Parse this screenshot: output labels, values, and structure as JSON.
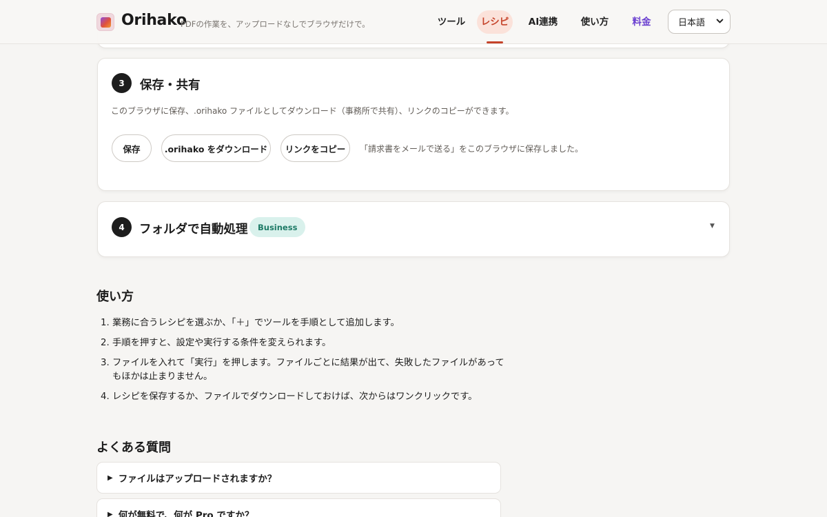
{
  "header": {
    "brand": "Orihako",
    "tagline": "PDFの作業を、アップロードなしでブラウザだけで。",
    "nav": [
      {
        "label": "ツール",
        "active": false
      },
      {
        "label": "レシピ",
        "active": true
      },
      {
        "label": "AI連携",
        "active": false
      },
      {
        "label": "使い方",
        "active": false
      },
      {
        "label": "料金",
        "active": false
      }
    ],
    "language": "日本語"
  },
  "step3": {
    "number": "3",
    "title": "保存・共有",
    "description": "このブラウザに保存、.orihako ファイルとしてダウンロード（事務所で共有）、リンクのコピーができます。",
    "buttons": {
      "save": "保存",
      "download": ".orihako をダウンロード",
      "copy_link": "リンクをコピー"
    },
    "status": "「請求書をメールで送る」をこのブラウザに保存しました。"
  },
  "step4": {
    "number": "4",
    "title": "フォルダで自動処理",
    "badge": "Business",
    "caret": "▼"
  },
  "howto": {
    "title": "使い方",
    "items": [
      {
        "num": "1.",
        "text": "業務に合うレシピを選ぶか、「＋」でツールを手順として追加します。"
      },
      {
        "num": "2.",
        "text": "手順を押すと、設定や実行する条件を変えられます。"
      },
      {
        "num": "3.",
        "text": "ファイルを入れて「実行」を押します。ファイルごとに結果が出て、失敗したファイルがあってもほかは止まりません。"
      },
      {
        "num": "4.",
        "text": "レシピを保存するか、ファイルでダウンロードしておけば、次からはワンクリックです。"
      }
    ]
  },
  "faq": {
    "title": "よくある質問",
    "items": [
      {
        "q": "ファイルはアップロードされますか？"
      },
      {
        "q": "何が無料で、何が Pro ですか？"
      }
    ]
  },
  "colors": {
    "accent": "#c5432a",
    "pricing": "#6a3fd0",
    "business_badge_bg": "#d9f1ec",
    "business_badge_text": "#1d7a66"
  }
}
